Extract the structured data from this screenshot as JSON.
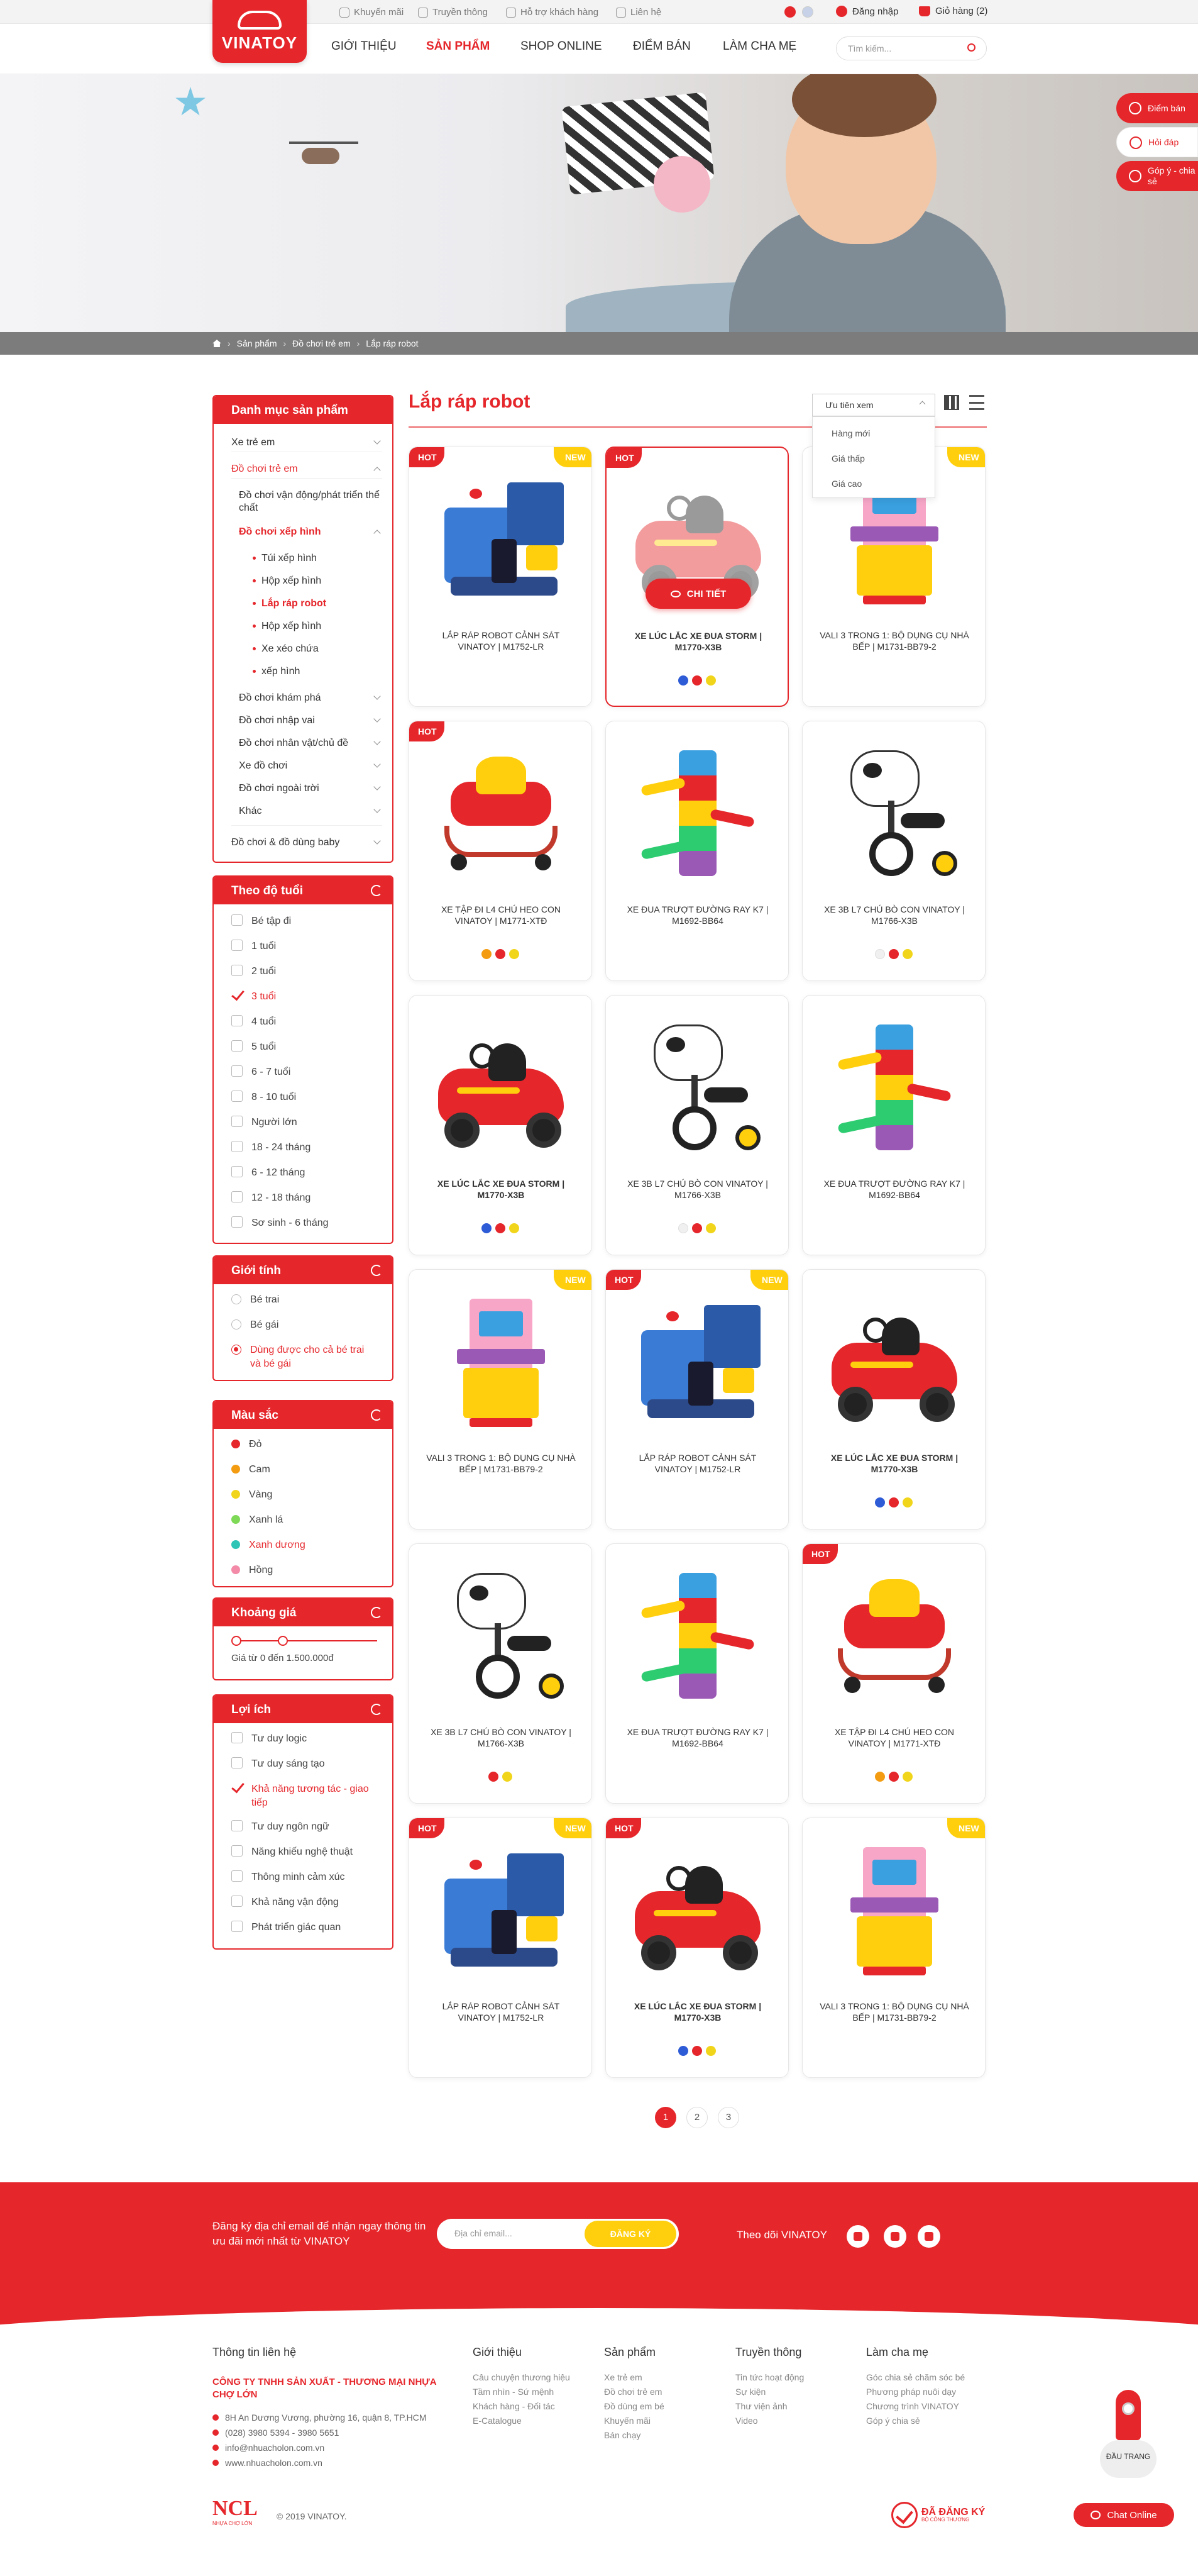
{
  "topbar": {
    "promo": "Khuyến mãi",
    "media": "Truyền thông",
    "support": "Hỗ trợ khách hàng",
    "contact": "Liên hệ",
    "login": "Đăng nhập",
    "cart": "Giỏ hàng (2)"
  },
  "header": {
    "logo": "VINATOY",
    "nav": [
      "GIỚI THIỆU",
      "SẢN PHẨM",
      "SHOP ONLINE",
      "ĐIỂM BÁN",
      "LÀM CHA MẸ"
    ],
    "search_placeholder": "Tìm kiếm..."
  },
  "breadcrumb": [
    "Sản phẩm",
    "Đồ chơi trẻ em",
    "Lắp ráp robot"
  ],
  "floating": [
    "Điểm bán",
    "Hỏi đáp",
    "Góp ý - chia sẻ"
  ],
  "sidebar": {
    "categories": {
      "title": "Danh mục sản phẩm",
      "items": [
        "Xe trẻ em",
        "Đồ chơi trẻ em",
        "Đồ chơi vận động/phát triển thể chất",
        "Đồ chơi xếp hình",
        "Túi xếp hình",
        "Hộp xếp hình",
        "Lắp ráp robot",
        "Hộp xếp hình",
        "Xe xéo chứa",
        "xếp hình",
        "Đồ chơi khám phá",
        "Đồ chơi nhập vai",
        "Đồ chơi nhân vật/chủ đề",
        "Xe đồ chơi",
        "Đồ chơi ngoài trời",
        "Khác",
        "Đồ chơi & đồ dùng baby"
      ]
    },
    "age": {
      "title": "Theo độ tuổi",
      "options": [
        "Bé tập đi",
        "1 tuổi",
        "2 tuổi",
        "3 tuổi",
        "4 tuổi",
        "5 tuổi",
        "6 - 7 tuổi",
        "8 - 10 tuổi",
        "Người lớn",
        "18 - 24 tháng",
        "6 - 12 tháng",
        "12 - 18 tháng",
        "Sơ sinh - 6 tháng"
      ],
      "checked": "3 tuổi"
    },
    "gender": {
      "title": "Giới tính",
      "options": [
        "Bé trai",
        "Bé gái",
        "Dùng được cho cả bé trai và bé gái"
      ],
      "selected": "Dùng được cho cả bé trai và bé gái"
    },
    "colors": {
      "title": "Màu sắc",
      "options": [
        {
          "name": "Đỏ",
          "hex": "#e5262b"
        },
        {
          "name": "Cam",
          "hex": "#f39c12"
        },
        {
          "name": "Vàng",
          "hex": "#f1d51b"
        },
        {
          "name": "Xanh lá",
          "hex": "#7ed957"
        },
        {
          "name": "Xanh dương",
          "hex": "#2ec4b6"
        },
        {
          "name": "Hồng",
          "hex": "#f38ba8"
        }
      ],
      "selected": "Xanh dương"
    },
    "price": {
      "title": "Khoảng giá",
      "range_text": "Giá từ 0 đến 1.500.000đ",
      "min_fraction": 0,
      "max_fraction": 0.33
    },
    "benefits": {
      "title": "Lợi ích",
      "options": [
        "Tư duy logic",
        "Tư duy sáng tạo",
        "Khả năng tương tác - giao tiếp",
        "Tư duy ngôn ngữ",
        "Năng khiếu nghệ thuật",
        "Thông minh cảm xúc",
        "Khả năng vận động",
        "Phát triển giác quan"
      ],
      "checked": "Khả năng tương tác - giao tiếp"
    }
  },
  "main": {
    "title": "Lắp ráp robot",
    "sort": {
      "selected": "Ưu tiên xem",
      "options": [
        "Hàng mới",
        "Giá thấp",
        "Giá cao"
      ]
    },
    "detail_button": "CHI TIẾT",
    "products": [
      {
        "name": "LẮP RÁP ROBOT CẢNH SÁT VINATOY | M1752-LR",
        "hot": "HOT",
        "new": "NEW",
        "toy": "robot",
        "colors": [],
        "bold": false
      },
      {
        "name": "XE LÚC LẮC XE ĐUA STORM | M1770-X3B",
        "hot": "HOT",
        "new": "",
        "toy": "car",
        "colors": [
          "#2e5bd6",
          "#e5262b",
          "#f1d51b"
        ],
        "bold": true
      },
      {
        "name": "VALI 3 TRONG 1: BỘ DỤNG CỤ NHÀ BẾP | M1731-BB79-2",
        "hot": "",
        "new": "NEW",
        "toy": "kitchen",
        "colors": [],
        "bold": false
      },
      {
        "name": "XE TẬP ĐI L4 CHÚ HEO CON VINATOY | M1771-XTĐ",
        "hot": "HOT",
        "new": "",
        "toy": "walker",
        "colors": [
          "#f39c12",
          "#e5262b",
          "#f1d51b"
        ],
        "bold": false
      },
      {
        "name": "XE ĐUA TRƯỢT ĐƯỜNG RAY K7 | M1692-BB64",
        "hot": "",
        "new": "",
        "toy": "tower",
        "colors": [],
        "bold": false
      },
      {
        "name": "XE 3B L7 CHÚ BÒ CON VINATOY | M1766-X3B",
        "hot": "",
        "new": "",
        "toy": "cow",
        "colors": [
          "#f0f0f0",
          "#e5262b",
          "#f1d51b"
        ],
        "bold": false
      },
      {
        "name": "XE LÚC LẮC XE ĐUA STORM | M1770-X3B",
        "hot": "",
        "new": "",
        "toy": "car",
        "colors": [
          "#2e5bd6",
          "#e5262b",
          "#f1d51b"
        ],
        "bold": true
      },
      {
        "name": "XE 3B L7 CHÚ BÒ CON VINATOY | M1766-X3B",
        "hot": "",
        "new": "",
        "toy": "cow",
        "colors": [
          "#f0f0f0",
          "#e5262b",
          "#f1d51b"
        ],
        "bold": false
      },
      {
        "name": "XE ĐUA TRƯỢT ĐƯỜNG RAY K7 | M1692-BB64",
        "hot": "",
        "new": "",
        "toy": "tower",
        "colors": [],
        "bold": false
      },
      {
        "name": "VALI 3 TRONG 1: BỘ DỤNG CỤ NHÀ BẾP | M1731-BB79-2",
        "hot": "",
        "new": "NEW",
        "toy": "kitchen",
        "colors": [],
        "bold": false
      },
      {
        "name": "LẮP RÁP ROBOT CẢNH SÁT VINATOY | M1752-LR",
        "hot": "HOT",
        "new": "NEW",
        "toy": "robot",
        "colors": [],
        "bold": false
      },
      {
        "name": "XE LÚC LẮC XE ĐUA STORM | M1770-X3B",
        "hot": "",
        "new": "",
        "toy": "car",
        "colors": [
          "#2e5bd6",
          "#e5262b",
          "#f1d51b"
        ],
        "bold": true
      },
      {
        "name": "XE 3B L7 CHÚ BÒ CON VINATOY | M1766-X3B",
        "hot": "",
        "new": "",
        "toy": "cow",
        "colors": [
          "#e5262b",
          "#f1d51b"
        ],
        "bold": false
      },
      {
        "name": "XE ĐUA TRƯỢT ĐƯỜNG RAY K7 | M1692-BB64",
        "hot": "",
        "new": "",
        "toy": "tower",
        "colors": [],
        "bold": false
      },
      {
        "name": "XE TẬP ĐI L4 CHÚ HEO CON VINATOY | M1771-XTĐ",
        "hot": "HOT",
        "new": "",
        "toy": "walker",
        "colors": [
          "#f39c12",
          "#e5262b",
          "#f1d51b"
        ],
        "bold": false
      },
      {
        "name": "LẮP RÁP ROBOT CẢNH SÁT VINATOY | M1752-LR",
        "hot": "HOT",
        "new": "NEW",
        "toy": "robot",
        "colors": [],
        "bold": false
      },
      {
        "name": "XE LÚC LẮC XE ĐUA STORM | M1770-X3B",
        "hot": "HOT",
        "new": "",
        "toy": "car",
        "colors": [
          "#2e5bd6",
          "#e5262b",
          "#f1d51b"
        ],
        "bold": true
      },
      {
        "name": "VALI 3 TRONG 1: BỘ DỤNG CỤ NHÀ BẾP | M1731-BB79-2",
        "hot": "",
        "new": "NEW",
        "toy": "kitchen",
        "colors": [],
        "bold": false
      }
    ],
    "pages": [
      "1",
      "2",
      "3"
    ],
    "current_page": "1"
  },
  "newsletter": {
    "text": "Đăng ký địa chỉ email để nhận ngay thông tin ưu đãi mới nhất từ VINATOY",
    "placeholder": "Địa chỉ email...",
    "button": "ĐĂNG KÝ",
    "follow": "Theo dõi VINATOY"
  },
  "footer": {
    "contact_title": "Thông tin liên hệ",
    "company": "CÔNG TY TNHH SẢN XUẤT - THƯƠNG MẠI NHỰA CHỢ LỚN",
    "address": "8H An Dương Vương, phường 16, quận 8, TP.HCM",
    "phone": "(028) 3980 5394 - 3980 5651",
    "email": "info@nhuacholon.com.vn",
    "web": "www.nhuacholon.com.vn",
    "columns": [
      {
        "title": "Giới thiệu",
        "links": [
          "Câu chuyện thương hiệu",
          "Tầm nhìn - Sứ mệnh",
          "Khách hàng - Đối tác",
          "E-Catalogue"
        ]
      },
      {
        "title": "Sản phẩm",
        "links": [
          "Xe trẻ em",
          "Đồ chơi trẻ em",
          "Đồ dùng em bé",
          "Khuyến mãi",
          "Bán chạy"
        ]
      },
      {
        "title": "Truyền thông",
        "links": [
          "Tin tức hoạt động",
          "Sự kiện",
          "Thư viện ảnh",
          "Video"
        ]
      },
      {
        "title": "Làm cha mẹ",
        "links": [
          "Góc chia sẻ chăm sóc bé",
          "Phương pháp nuôi dạy",
          "Chương trình VINATOY",
          "Góp ý chia sẻ"
        ]
      }
    ],
    "ncl_logo": "NCL",
    "ncl_sub": "NHỰA CHỢ LỚN",
    "copyright": "© 2019 VINATOY.",
    "registered": "ĐÃ ĐĂNG KÝ",
    "registered_sub": "BỘ CÔNG THƯƠNG",
    "back_to_top": "ĐẦU TRANG",
    "chat": "Chat Online"
  }
}
